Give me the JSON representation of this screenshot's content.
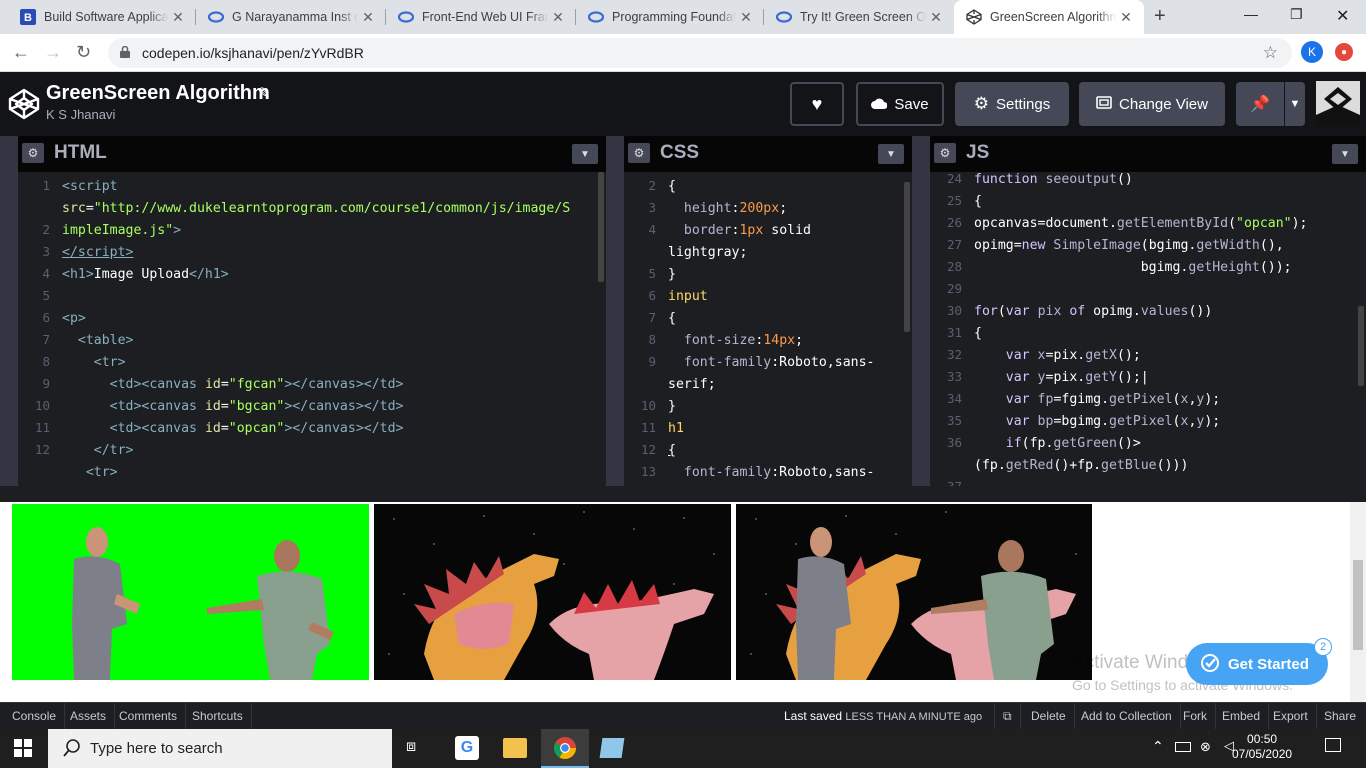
{
  "browser": {
    "tabs": [
      {
        "title": "Build Software Applicat",
        "icon": "b-logo-icon"
      },
      {
        "title": "G Narayanamma Inst of",
        "icon": "codepen-ring-icon"
      },
      {
        "title": "Front-End Web UI Fram",
        "icon": "codepen-ring-icon"
      },
      {
        "title": "Programming Foundati",
        "icon": "codepen-ring-icon"
      },
      {
        "title": "Try It! Green Screen Onl",
        "icon": "codepen-ring-icon"
      },
      {
        "title": "GreenScreen Algorithm",
        "icon": "codepen-logo-icon",
        "active": true
      }
    ],
    "url": "codepen.io/ksjhanavi/pen/zYvRdBR",
    "avatar_letter": "K"
  },
  "pen": {
    "title": "GreenScreen Algorithm",
    "author": "K S Jhanavi",
    "buttons": {
      "save": "Save",
      "settings": "Settings",
      "change_view": "Change View"
    }
  },
  "editors": {
    "html": {
      "name": "HTML",
      "line_numbers": [
        "1",
        "",
        "2",
        "3",
        "4",
        "5",
        "6",
        "7",
        "8",
        "9",
        "10",
        "11",
        "12"
      ]
    },
    "css": {
      "name": "CSS",
      "line_numbers": [
        "2",
        "3",
        "4",
        "",
        "5",
        "6",
        "7",
        "8",
        "9",
        "",
        "10",
        "11",
        "12",
        "13"
      ]
    },
    "js": {
      "name": "JS",
      "line_numbers": [
        "24",
        "25",
        "26",
        "27",
        "28",
        "29",
        "30",
        "31",
        "32",
        "33",
        "34",
        "35",
        "36",
        "",
        "37"
      ]
    }
  },
  "result": {
    "watermark_title": "Activate Windows",
    "watermark_sub": "Go to Settings to activate Windows.",
    "get_started": "Get Started",
    "get_started_badge": "2"
  },
  "bottom_bar": {
    "left": [
      "Console",
      "Assets",
      "Comments",
      "Shortcuts"
    ],
    "last_saved_label": "Last saved",
    "last_saved_value": "LESS THAN A MINUTE ago",
    "right": [
      "Delete",
      "Add to Collection",
      "Fork",
      "Embed",
      "Export",
      "Share"
    ]
  },
  "taskbar": {
    "search_placeholder": "Type here to search",
    "time": "00:50",
    "date": "07/05/2020"
  },
  "colors": {
    "codepen_bg": "#131417",
    "button_bg": "#444857",
    "editor_bg": "#1d1e22",
    "green_screen": "#00ff00",
    "get_started_blue": "#47a3f3"
  }
}
